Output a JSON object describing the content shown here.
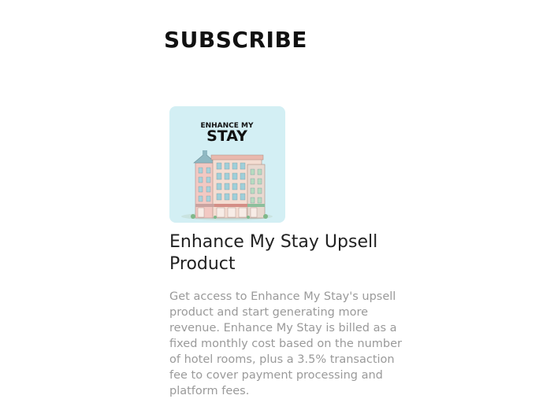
{
  "page": {
    "heading": "SUBSCRIBE"
  },
  "product": {
    "image": {
      "logo_line1": "ENHANCE MY",
      "logo_line2": "STAY",
      "background_color": "#d3eff4",
      "icon": "hotel-building-illustration"
    },
    "title": "Enhance My Stay Upsell Product",
    "description": "Get access to Enhance My Stay's upsell product and start generating more revenue. Enhance My Stay is billed as a fixed monthly cost based on the number of hotel rooms, plus a 3.5% transaction fee to cover payment processing and platform fees."
  }
}
